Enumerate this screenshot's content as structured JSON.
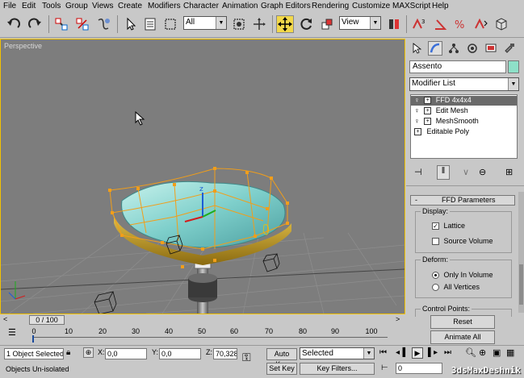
{
  "menu": [
    "File",
    "Edit",
    "Tools",
    "Group",
    "Views",
    "Create",
    "Modifiers",
    "Character",
    "Animation",
    "Graph Editors",
    "Rendering",
    "Customize",
    "MAXScript",
    "Help"
  ],
  "toolbar": {
    "selection_filter": "All",
    "reference_coord": "View",
    "icons": [
      "undo-icon",
      "redo-icon",
      "select-link-icon",
      "unlink-icon",
      "bind-spacewarp-icon",
      "select-object-icon",
      "select-by-name-icon",
      "rect-selection-icon",
      "window-crossing-icon",
      "select-move-icon",
      "select-rotate-icon",
      "select-scale-icon",
      "use-pivot-icon",
      "mirror-icon",
      "align-icon",
      "layer-manager-icon",
      "curve-editor-icon",
      "schematic-view-icon",
      "material-editor-icon",
      "render-scene-icon",
      "quick-render-icon"
    ]
  },
  "viewport": {
    "label": "Perspective"
  },
  "command_panel": {
    "object_name": "Assento",
    "object_color": "#8ee0c8",
    "modifier_list_label": "Modifier List",
    "stack": [
      {
        "label": "FFD 4x4x4",
        "selected": true,
        "type": "modifier"
      },
      {
        "label": "Edit Mesh",
        "selected": false,
        "type": "modifier"
      },
      {
        "label": "MeshSmooth",
        "selected": false,
        "type": "modifier"
      },
      {
        "label": "Editable Poly",
        "selected": false,
        "type": "base"
      }
    ],
    "rollout_title": "FFD Parameters",
    "rollout_toggle": "-",
    "display": {
      "title": "Display:",
      "lattice": "Lattice",
      "lattice_checked": true,
      "source_volume": "Source Volume",
      "source_volume_checked": false
    },
    "deform": {
      "title": "Deform:",
      "only_in_volume": "Only In Volume",
      "all_vertices": "All Vertices",
      "selected": "only_in_volume"
    },
    "control_points": {
      "title": "Control Points:",
      "reset": "Reset",
      "animate_all": "Animate All"
    }
  },
  "timeline": {
    "slider_label": "0 / 100",
    "ticks": [
      "0",
      "10",
      "20",
      "30",
      "40",
      "50",
      "60",
      "70",
      "80",
      "90",
      "100"
    ]
  },
  "status": {
    "selection": "1 Object Selected",
    "prompt": "Objects Un-isolated",
    "x_label": "X:",
    "x_value": "0,0",
    "y_label": "Y:",
    "y_value": "0,0",
    "z_label": "Z:",
    "z_value": "70,328",
    "auto_key": "Auto Key",
    "set_key": "Set Key",
    "key_mode": "Selected",
    "key_filters": "Key Filters...",
    "frame": "0"
  },
  "watermark": "3dsMaxDeshnik"
}
